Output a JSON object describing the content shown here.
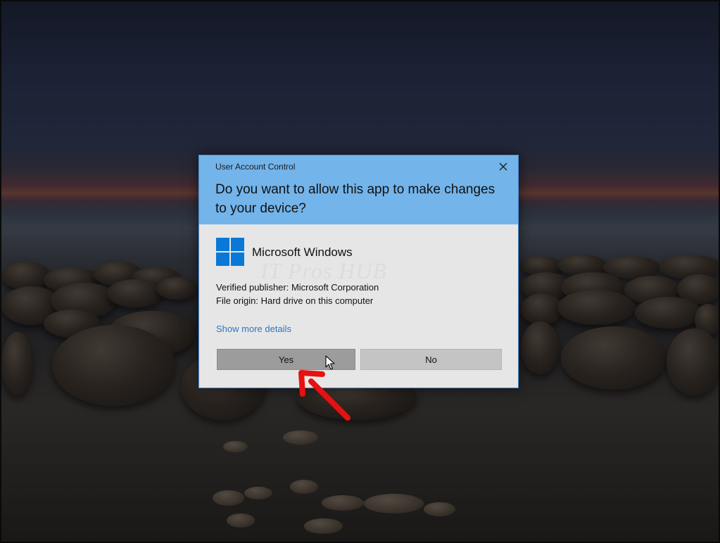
{
  "dialog": {
    "caption": "User Account Control",
    "question": "Do you want to allow this app to make changes to your device?",
    "app_name": "Microsoft Windows",
    "publisher": "Verified publisher: Microsoft Corporation",
    "origin": "File origin: Hard drive on this computer",
    "details_link": "Show more details",
    "yes_label": "Yes",
    "no_label": "No"
  },
  "watermark": "IT Pros HUB",
  "icons": {
    "close": "close-icon",
    "app": "windows-logo-icon",
    "cursor": "mouse-pointer-icon",
    "annotation": "red-arrow-icon"
  },
  "colors": {
    "header": "#73b4ea",
    "body": "#e6e6e6",
    "link": "#2a78c4",
    "windows_blue": "#0a78d7",
    "arrow_red": "#e81010"
  }
}
